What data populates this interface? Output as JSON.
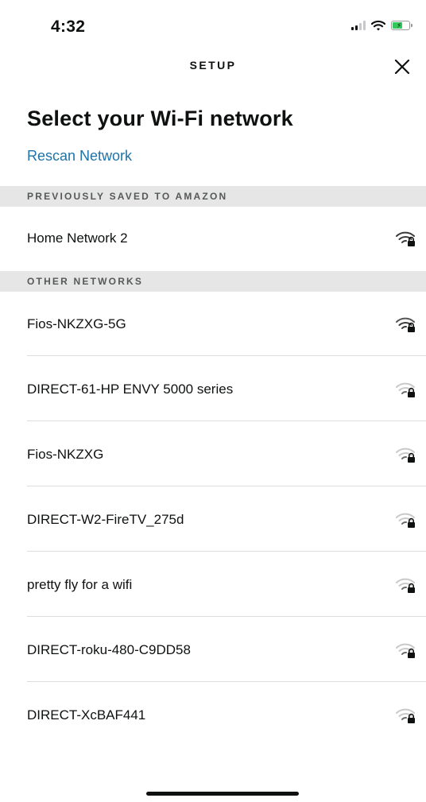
{
  "status_bar": {
    "time": "4:32",
    "icons": [
      "cellular-signal-icon",
      "wifi-icon",
      "battery-charging-icon"
    ]
  },
  "header": {
    "title": "SETUP",
    "close_icon": "close-icon"
  },
  "page": {
    "title": "Select your Wi-Fi network",
    "rescan_label": "Rescan Network",
    "link_color": "#1f73a8"
  },
  "sections": {
    "saved_header": "PREVIOUSLY SAVED TO AMAZON",
    "other_header": "OTHER NETWORKS"
  },
  "saved_networks": [
    {
      "name": "Home Network 2",
      "signal_strength": "strong",
      "secured": true
    }
  ],
  "other_networks": [
    {
      "name": "Fios-NKZXG-5G",
      "signal_strength": "strong",
      "secured": true
    },
    {
      "name": "DIRECT-61-HP ENVY 5000 series",
      "signal_strength": "weak",
      "secured": true
    },
    {
      "name": "Fios-NKZXG",
      "signal_strength": "weak",
      "secured": true
    },
    {
      "name": "DIRECT-W2-FireTV_275d",
      "signal_strength": "weak",
      "secured": true
    },
    {
      "name": "pretty fly for a wifi",
      "signal_strength": "weak",
      "secured": true
    },
    {
      "name": "DIRECT-roku-480-C9DD58",
      "signal_strength": "weak",
      "secured": true
    },
    {
      "name": "DIRECT-XcBAF441",
      "signal_strength": "weak",
      "secured": true
    }
  ]
}
